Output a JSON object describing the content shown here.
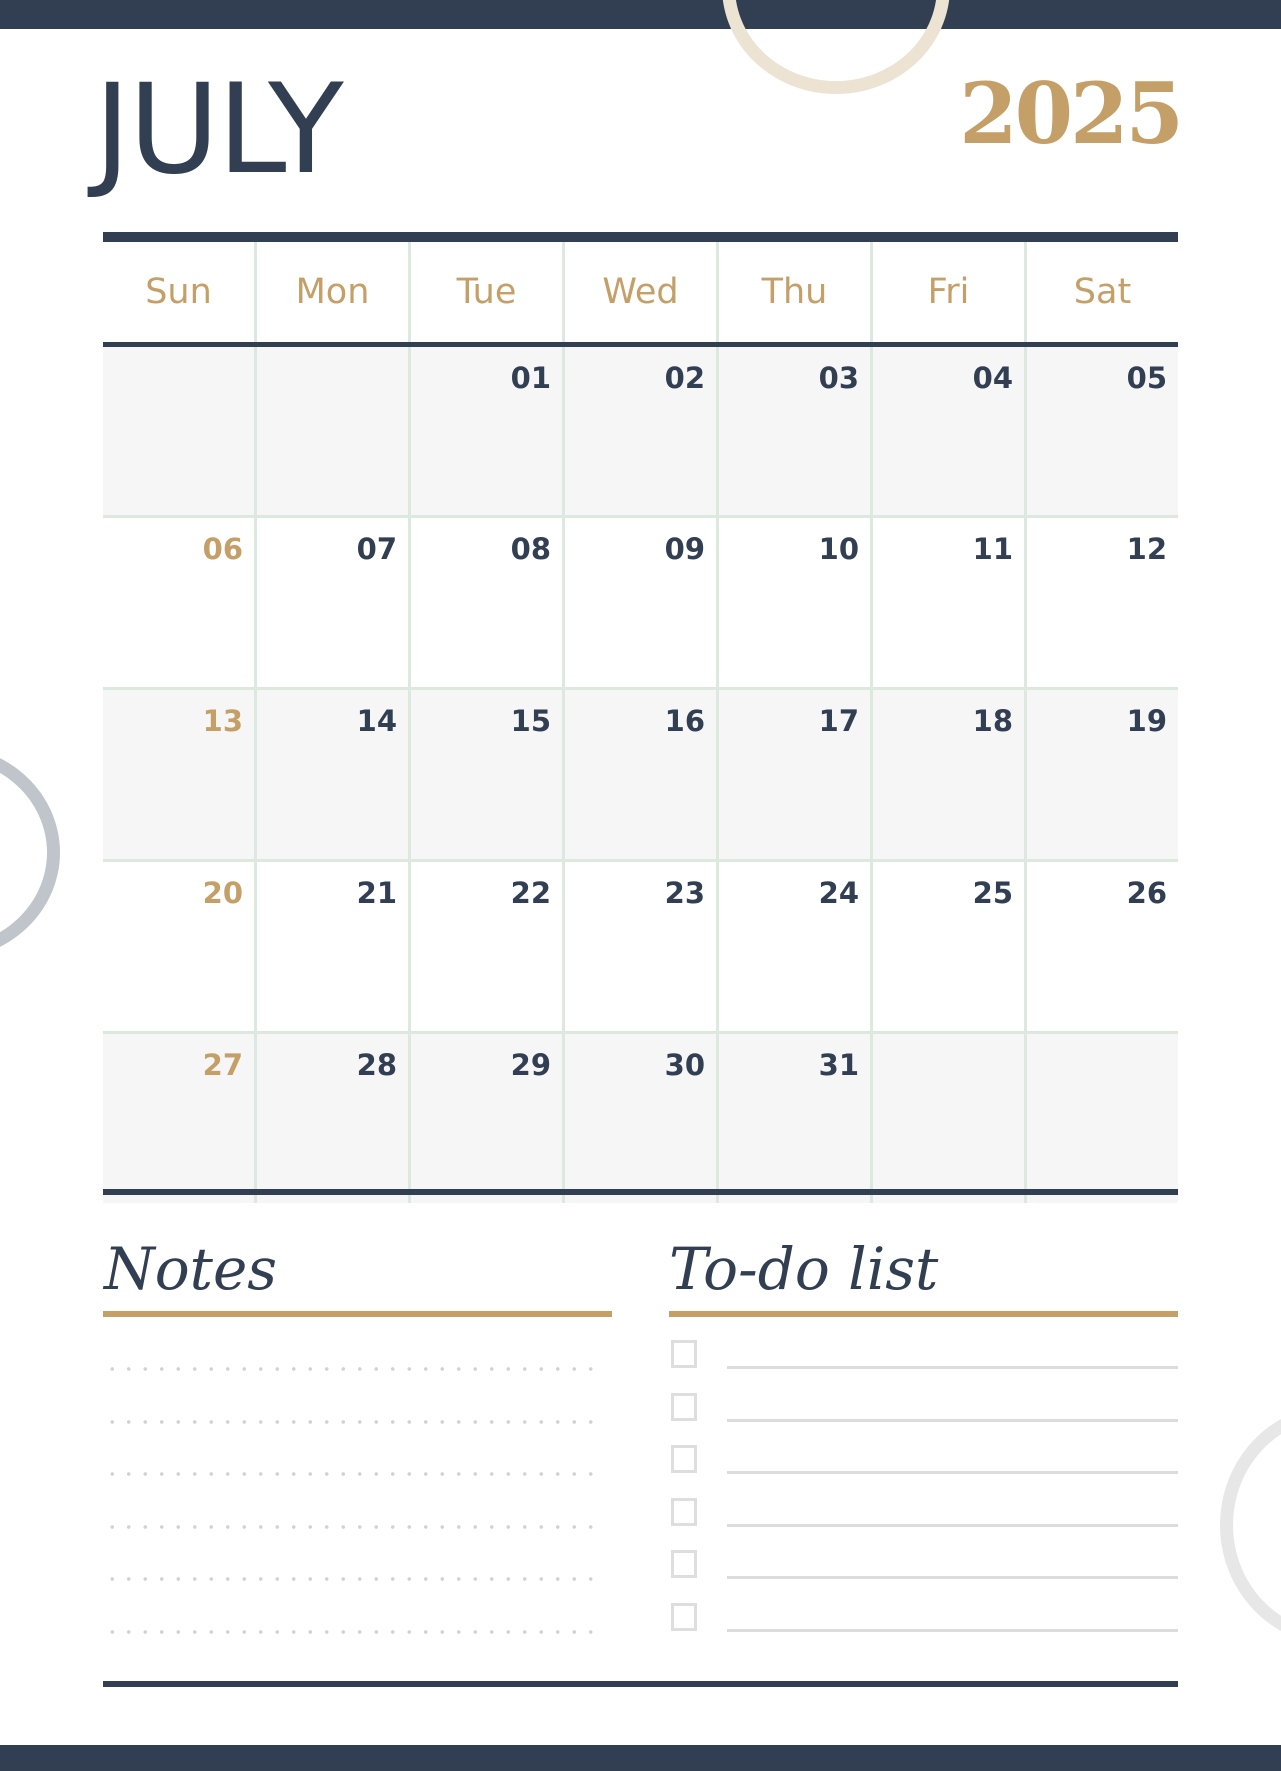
{
  "header": {
    "month": "JULY",
    "year": "2025"
  },
  "colors": {
    "navy": "#323f52",
    "gold": "#c4a068",
    "grid_line": "#dde9de",
    "shaded_row": "#f6f6f6"
  },
  "weekdays": [
    "Sun",
    "Mon",
    "Tue",
    "Wed",
    "Thu",
    "Fri",
    "Sat"
  ],
  "weeks": [
    [
      "",
      "",
      "01",
      "02",
      "03",
      "04",
      "05"
    ],
    [
      "06",
      "07",
      "08",
      "09",
      "10",
      "11",
      "12"
    ],
    [
      "13",
      "14",
      "15",
      "16",
      "17",
      "18",
      "19"
    ],
    [
      "20",
      "21",
      "22",
      "23",
      "24",
      "25",
      "26"
    ],
    [
      "27",
      "28",
      "29",
      "30",
      "31",
      "",
      ""
    ]
  ],
  "notes": {
    "title": "Notes",
    "line_count": 6
  },
  "todo": {
    "title": "To-do list",
    "item_count": 6
  }
}
